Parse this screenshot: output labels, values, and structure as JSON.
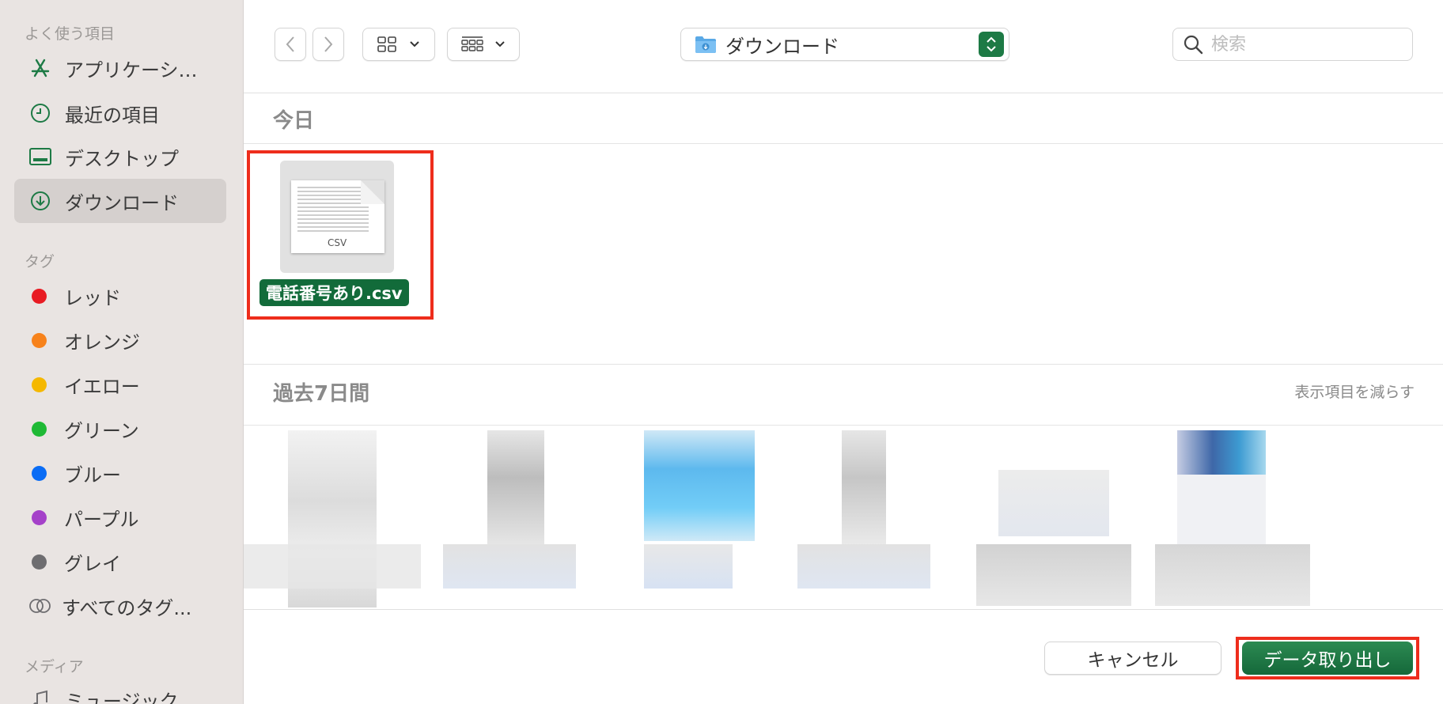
{
  "sidebar": {
    "favorites_title": "よく使う項目",
    "favorites": [
      {
        "label": "アプリケーシ…",
        "icon": "applications-icon"
      },
      {
        "label": "最近の項目",
        "icon": "clock-icon"
      },
      {
        "label": "デスクトップ",
        "icon": "desktop-icon"
      },
      {
        "label": "ダウンロード",
        "icon": "download-icon",
        "selected": true
      }
    ],
    "tags_title": "タグ",
    "tags": [
      {
        "label": "レッド",
        "color": "#e81b23"
      },
      {
        "label": "オレンジ",
        "color": "#f7821b"
      },
      {
        "label": "イエロー",
        "color": "#f5b800"
      },
      {
        "label": "グリーン",
        "color": "#1fb935"
      },
      {
        "label": "ブルー",
        "color": "#0a6cf5"
      },
      {
        "label": "パープル",
        "color": "#a541c9"
      },
      {
        "label": "グレイ",
        "color": "#6e6d70"
      }
    ],
    "all_tags": "すべてのタグ...",
    "media_title": "メディア",
    "media": [
      {
        "label": "ミュージック",
        "icon": "music-icon"
      }
    ]
  },
  "toolbar": {
    "location": "ダウンロード",
    "search_placeholder": "検索"
  },
  "content": {
    "today_title": "今日",
    "file_name": "電話番号あり.csv",
    "file_ext": "CSV",
    "past_title": "過去7日間",
    "show_less": "表示項目を減らす"
  },
  "footer": {
    "cancel": "キャンセル",
    "confirm": "データ取り出し"
  },
  "colors": {
    "accent": "#1d7a45",
    "highlight": "#ee2d1c"
  }
}
